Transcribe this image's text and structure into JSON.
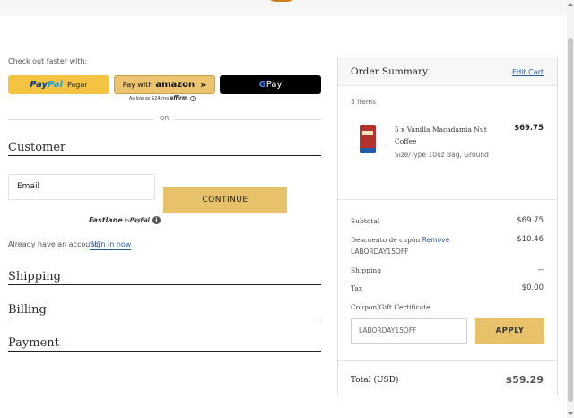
{
  "express": {
    "heading": "Check out faster with:",
    "paypal": {
      "pay": "Pay",
      "pal": "Pal",
      "pagar": "Pagar"
    },
    "amazon": {
      "prefix": "Pay with",
      "brand": "amazon",
      "chevrons": "»"
    },
    "gpay": {
      "g": "G",
      "pay": " Pay"
    },
    "affirm": {
      "text": "As low as $24/mo",
      "brand": "affirm"
    },
    "or": "OR"
  },
  "customer": {
    "title": "Customer",
    "email_label": "Email",
    "continue": "CONTINUE",
    "fastlane": {
      "name": "Fastlane",
      "by": "by",
      "paypal": "PayPal"
    },
    "already": "Already have an account?",
    "sign_in": "Sign in now"
  },
  "sections": {
    "shipping": "Shipping",
    "billing": "Billing",
    "payment": "Payment"
  },
  "summary": {
    "title": "Order Summary",
    "edit_cart": "Edit Cart",
    "items_count": "5 items",
    "product": {
      "name": "5 x Vanilla Macadamia Nut Coffee",
      "price": "$69.75",
      "size": "Size/Type 10oz Bag, Ground"
    },
    "subtotal_label": "Subtotal",
    "subtotal_value": "$69.75",
    "discount_label": "Descuento de cupón",
    "remove": "Remove",
    "discount_value": "-$10.46",
    "discount_code": "LABORDAY15OFF",
    "shipping_label": "Shipping",
    "shipping_value": "--",
    "tax_label": "Tax",
    "tax_value": "$0.00",
    "coupon_label": "Coupon/Gift Certificate",
    "coupon_value": "LABORDAY15OFF",
    "apply": "APPLY",
    "total_label": "Total (USD)",
    "total_value": "$59.29"
  },
  "colors": {
    "accent_button": "#e8c26a",
    "paypal_button": "#f4c342",
    "link": "#2c5aa0"
  }
}
